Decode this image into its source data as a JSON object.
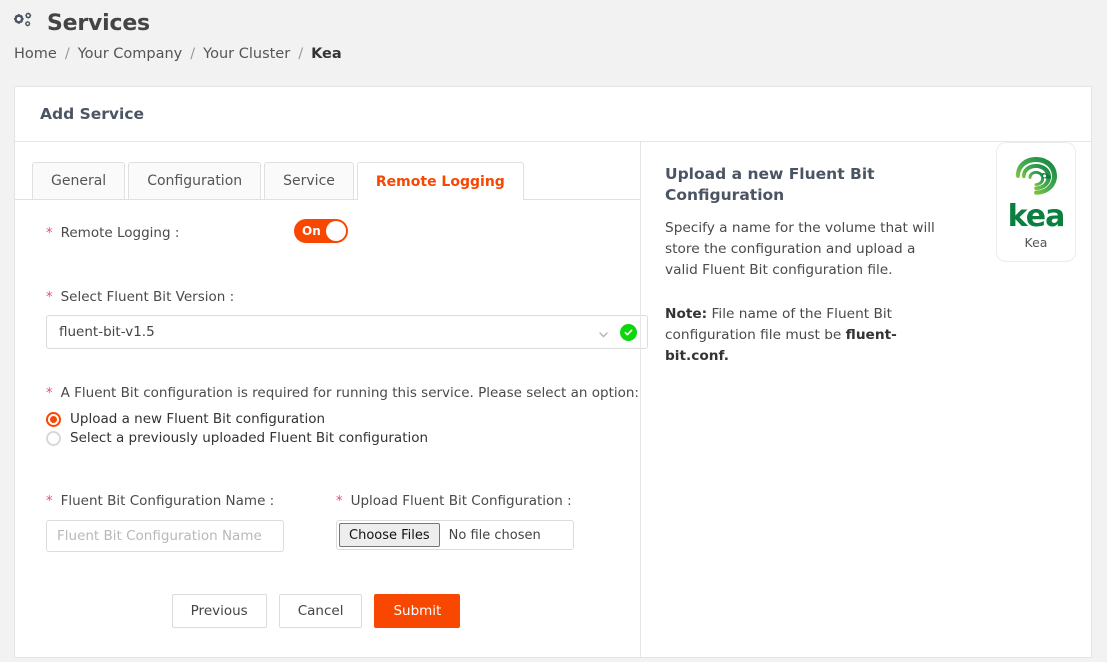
{
  "header": {
    "title": "Services",
    "icon": "cogs-icon"
  },
  "breadcrumb": {
    "items": [
      {
        "label": "Home",
        "active": false
      },
      {
        "label": "Your Company",
        "active": false
      },
      {
        "label": "Your Cluster",
        "active": false
      },
      {
        "label": "Kea",
        "active": true
      }
    ],
    "separator": "/"
  },
  "card": {
    "title": "Add Service"
  },
  "tabs": [
    {
      "label": "General",
      "active": false
    },
    {
      "label": "Configuration",
      "active": false
    },
    {
      "label": "Service",
      "active": false
    },
    {
      "label": "Remote Logging",
      "active": true
    }
  ],
  "form": {
    "required_marker": "*",
    "remote_logging": {
      "label": "Remote Logging :",
      "toggle_state": "On"
    },
    "fluent_bit_version": {
      "label": "Select Fluent Bit Version :",
      "value": "fluent-bit-v1.5",
      "validated": true
    },
    "config_option": {
      "label": "A Fluent Bit configuration is required for running this service. Please select an option:",
      "options": [
        {
          "label": "Upload a new Fluent Bit configuration",
          "selected": true
        },
        {
          "label": "Select a previously uploaded Fluent Bit configuration",
          "selected": false
        }
      ]
    },
    "config_name": {
      "label": "Fluent Bit Configuration Name :",
      "value": "",
      "placeholder": "Fluent Bit Configuration Name"
    },
    "upload": {
      "label": "Upload Fluent Bit Configuration :",
      "button_label": "Choose Files",
      "status": "No file chosen"
    },
    "buttons": {
      "previous": "Previous",
      "cancel": "Cancel",
      "submit": "Submit"
    }
  },
  "info": {
    "title": "Upload a new Fluent Bit Configuration",
    "body": "Specify a name for the volume that will store the configuration and upload a valid Fluent Bit configuration file.",
    "note_label": "Note:",
    "note_text_before": " File name of the Fluent Bit configuration file must be ",
    "note_filename": "fluent-bit.conf.",
    "logo": {
      "wordmark": "kea",
      "caption": "Kea"
    }
  },
  "colors": {
    "accent": "#f74701",
    "required": "#e8476d",
    "success": "#0ad80a",
    "brand_green": "#0a7f3f",
    "page_bg": "#f2f2f2"
  }
}
